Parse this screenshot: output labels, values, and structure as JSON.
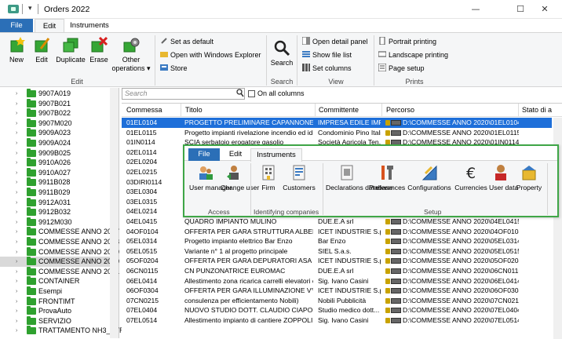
{
  "window": {
    "title": "Orders 2022",
    "qa_menu": "▾",
    "minimize": "—",
    "maximize": "☐",
    "close": "✕"
  },
  "tabs": {
    "file": "File",
    "edit": "Edit",
    "instruments": "Instruments"
  },
  "ribbon": {
    "new": "New",
    "edit": "Edit",
    "duplicate": "Duplicate",
    "erase": "Erase",
    "other_operations": "Other operations ▾",
    "group_edit": "Edit",
    "set_default": "Set as default",
    "open_explorer": "Open with Windows Explorer",
    "store": "Store",
    "search": "Search",
    "group_search": "Search",
    "open_detail": "Open detail panel",
    "show_file_list": "Show file list",
    "set_columns": "Set columns",
    "group_view": "View",
    "portrait": "Portrait printing",
    "landscape": "Landscape printing",
    "page_setup": "Page setup",
    "group_prints": "Prints"
  },
  "tree": {
    "items": [
      {
        "label": "9907A019",
        "selected": false
      },
      {
        "label": "9907B021",
        "selected": false
      },
      {
        "label": "9907B022",
        "selected": false
      },
      {
        "label": "9907M020",
        "selected": false
      },
      {
        "label": "9909A023",
        "selected": false
      },
      {
        "label": "9909A024",
        "selected": false
      },
      {
        "label": "9909B025",
        "selected": false
      },
      {
        "label": "9910A026",
        "selected": false
      },
      {
        "label": "9910A027",
        "selected": false
      },
      {
        "label": "9911B028",
        "selected": false
      },
      {
        "label": "9911B029",
        "selected": false
      },
      {
        "label": "9912A031",
        "selected": false
      },
      {
        "label": "9912B032",
        "selected": false
      },
      {
        "label": "9912M030",
        "selected": false
      },
      {
        "label": "COMMESSE ANNO 2017",
        "selected": false
      },
      {
        "label": "COMMESSE ANNO 2018",
        "selected": false
      },
      {
        "label": "COMMESSE ANNO 2019",
        "selected": false
      },
      {
        "label": "COMMESSE ANNO 2020",
        "selected": true
      },
      {
        "label": "COMMESSE ANNO 2021",
        "selected": false
      },
      {
        "label": "CONTAINER",
        "selected": false
      },
      {
        "label": "Esempi",
        "selected": false
      },
      {
        "label": "FRONTIMT",
        "selected": false
      },
      {
        "label": "ProvaAuto",
        "selected": false
      },
      {
        "label": "SERVIZIO",
        "selected": false
      },
      {
        "label": "TRATTAMENTO NH3_STR",
        "selected": false
      }
    ]
  },
  "search": {
    "placeholder": "Search",
    "on_all_columns": "On all columns"
  },
  "grid": {
    "columns": [
      "Commessa",
      "Titolo",
      "Committente",
      "Percorso",
      "Stato di a"
    ],
    "rows": [
      {
        "commessa": "01EL0104",
        "titolo": "PROGETTO PRELIMINARE CAPANNONE IN ...",
        "committente": "IMPRESA EDILE IMP...",
        "percorso": "D:\\COMMESSE ANNO 2020\\01EL0104...",
        "selected": true
      },
      {
        "commessa": "01EL0115",
        "titolo": "Progetto impianti rivelazione incendio ed idr...",
        "committente": "Condominio Pino Italico",
        "percorso": "D:\\COMMESSE ANNO 2020\\01EL0115...",
        "selected": false
      },
      {
        "commessa": "01IN0114",
        "titolo": "SCIA serbatoio erogatore gasolio",
        "committente": "Società Agricola Ten...",
        "percorso": "D:\\COMMESSE ANNO 2020\\01IN0114...",
        "selected": false
      },
      {
        "commessa": "02EL0114",
        "titolo": "",
        "committente": "",
        "percorso": "",
        "selected": false
      },
      {
        "commessa": "02EL0204",
        "titolo": "",
        "committente": "",
        "percorso": "",
        "selected": false
      },
      {
        "commessa": "02EL0215",
        "titolo": "",
        "committente": "",
        "percorso": "",
        "selected": false
      },
      {
        "commessa": "03DIRI0114",
        "titolo": "",
        "committente": "",
        "percorso": "",
        "selected": false
      },
      {
        "commessa": "03EL0304",
        "titolo": "",
        "committente": "",
        "percorso": "",
        "selected": false
      },
      {
        "commessa": "03EL0315",
        "titolo": "",
        "committente": "",
        "percorso": "",
        "selected": false
      },
      {
        "commessa": "04EL0214",
        "titolo": "",
        "committente": "",
        "percorso": "",
        "selected": false
      },
      {
        "commessa": "04EL0415",
        "titolo": "QUADRO IMPIANTO MULINO",
        "committente": "DUE.E.A srl",
        "percorso": "D:\\COMMESSE ANNO 2020\\04EL0415...",
        "selected": false
      },
      {
        "commessa": "04OF0104",
        "titolo": "OFFERTA PER GARA STRUTTURA ALBERG...",
        "committente": "ICET INDUSTRIE S.p...",
        "percorso": "D:\\COMMESSE ANNO 2020\\04OF0104...",
        "selected": false
      },
      {
        "commessa": "05EL0314",
        "titolo": "Progetto impianto elettrico Bar Enzo",
        "committente": "Bar Enzo",
        "percorso": "D:\\COMMESSE ANNO 2020\\05EL0314...",
        "selected": false
      },
      {
        "commessa": "05EL0515",
        "titolo": "Variante n° 1 al progetto principale",
        "committente": "SIEL S.a.s.",
        "percorso": "D:\\COMMESSE ANNO 2020\\05EL0515...",
        "selected": false
      },
      {
        "commessa": "05OF0204",
        "titolo": "OFFERTA PER GARA DEPURATORI ASA",
        "committente": "ICET INDUSTRIE S.p...",
        "percorso": "D:\\COMMESSE ANNO 2020\\05OF0204...",
        "selected": false
      },
      {
        "commessa": "06CN0115",
        "titolo": "CN PUNZONATRICE EUROMAC",
        "committente": "DUE.E.A srl",
        "percorso": "D:\\COMMESSE ANNO 2020\\06CN0115...",
        "selected": false
      },
      {
        "commessa": "06EL0414",
        "titolo": "Allestimento zona ricarica carrelli elevatori c...",
        "committente": "Sig. Ivano Casini",
        "percorso": "D:\\COMMESSE ANNO 2020\\06EL0414...",
        "selected": false
      },
      {
        "commessa": "06OF0304",
        "titolo": "OFFERTA PER GARA ILLUMINAZIONE V° M...",
        "committente": "ICET INDUSTRIE S.p...",
        "percorso": "D:\\COMMESSE ANNO 2020\\06OF0304...",
        "selected": false
      },
      {
        "commessa": "07CN0215",
        "titolo": "consulenza per efficientamento Nobili)",
        "committente": "Nobili Pubblicità",
        "percorso": "D:\\COMMESSE ANNO 2020\\07CN0215...",
        "selected": false
      },
      {
        "commessa": "07EL0404",
        "titolo": "NUOVO STUDIO DOTT. CLAUDIO CIAPONI ...",
        "committente": "Studio medico dott...",
        "percorso": "D:\\COMMESSE ANNO 2020\\07EL0404...",
        "selected": false
      },
      {
        "commessa": "07EL0514",
        "titolo": "Allestimento impianto di cantiere ZOPPOLI ...",
        "committente": "Sig. Ivano Casini",
        "percorso": "D:\\COMMESSE ANNO 2020\\07EL0514...",
        "selected": false
      }
    ]
  },
  "popup": {
    "tab_file": "File",
    "tab_edit": "Edit",
    "tab_instruments": "Instruments",
    "user_manager": "User manager",
    "change_user": "Change user",
    "group_access": "Access",
    "firm": "Firm",
    "customers": "Customers",
    "group_identifying": "Identifying companies",
    "declarations_db": "Declarations database",
    "preferences": "Preferences",
    "configurations": "Configurations",
    "currencies": "Currencies",
    "user_data": "User data",
    "property": "Property",
    "group_setup": "Setup"
  }
}
